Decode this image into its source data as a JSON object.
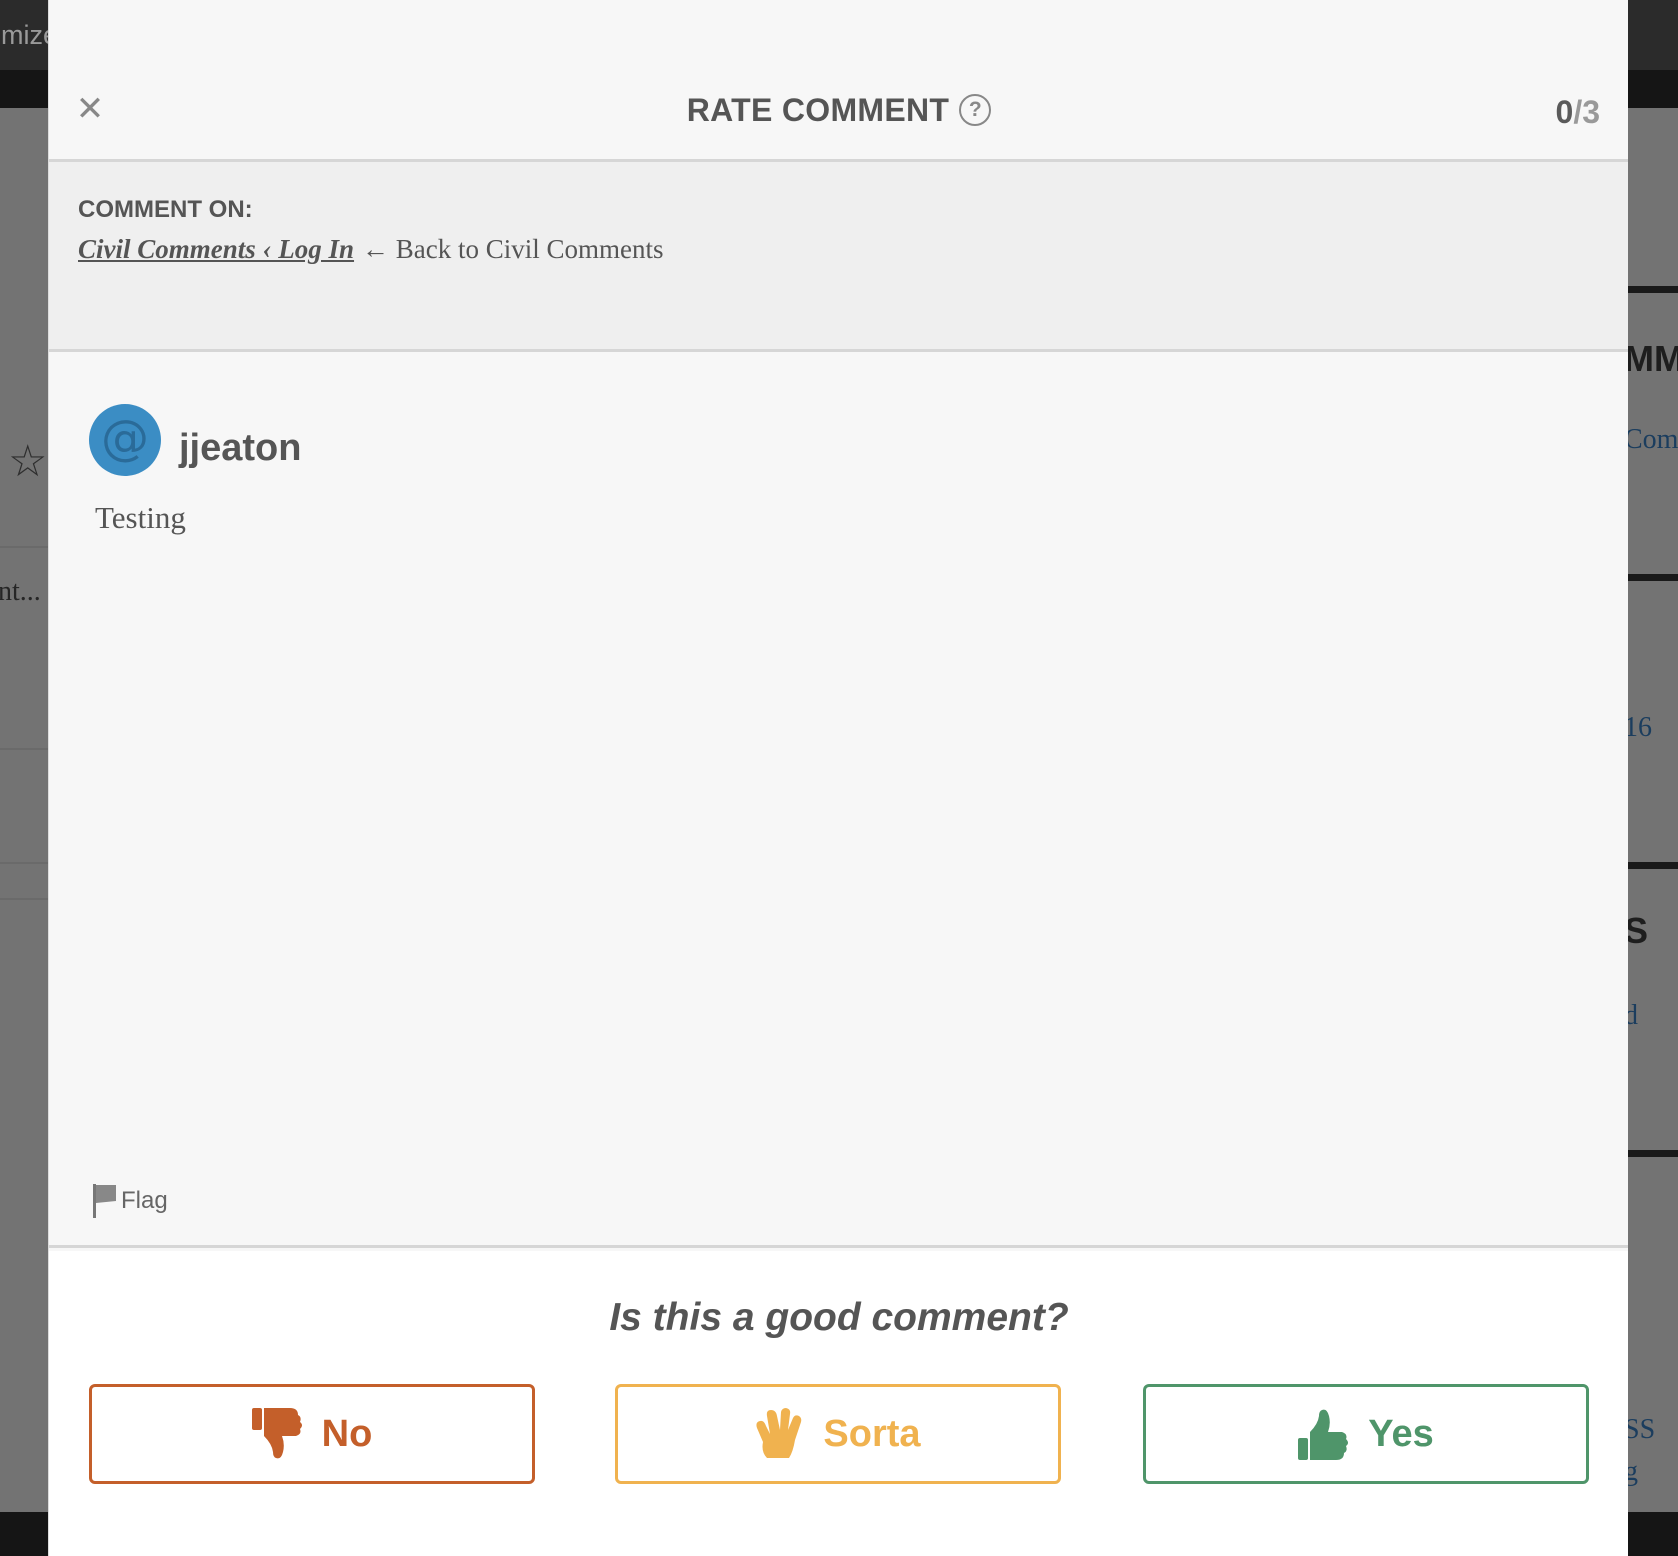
{
  "background": {
    "topbar_fragment": "omize",
    "left_fragment": "nt...",
    "right_fragments": [
      "MM",
      "Com",
      "16",
      "S",
      "d",
      "SS",
      "g"
    ]
  },
  "modal": {
    "close_icon": "close-icon",
    "title": "RATE COMMENT",
    "help_symbol": "?",
    "progress": {
      "done": "0",
      "separator": "/",
      "total": "3"
    }
  },
  "context": {
    "label": "COMMENT ON:",
    "link_text": "Civil Comments ‹ Log In",
    "tail_text": "← Back to Civil Comments"
  },
  "comment": {
    "avatar_symbol": "@",
    "username": "jjeaton",
    "body": "Testing",
    "flag_label": "Flag"
  },
  "rating": {
    "question": "Is this a good comment?",
    "buttons": [
      {
        "label": "No",
        "icon": "thumbs-down-icon",
        "color": "#c45f2a"
      },
      {
        "label": "Sorta",
        "icon": "hand-wave-icon",
        "color": "#f0b24f"
      },
      {
        "label": "Yes",
        "icon": "thumbs-up-icon",
        "color": "#4f956a"
      }
    ]
  },
  "colors": {
    "overlay": "#737373",
    "modal_bg": "#f7f7f7",
    "avatar": "#3b8dc4",
    "text": "#555555"
  }
}
